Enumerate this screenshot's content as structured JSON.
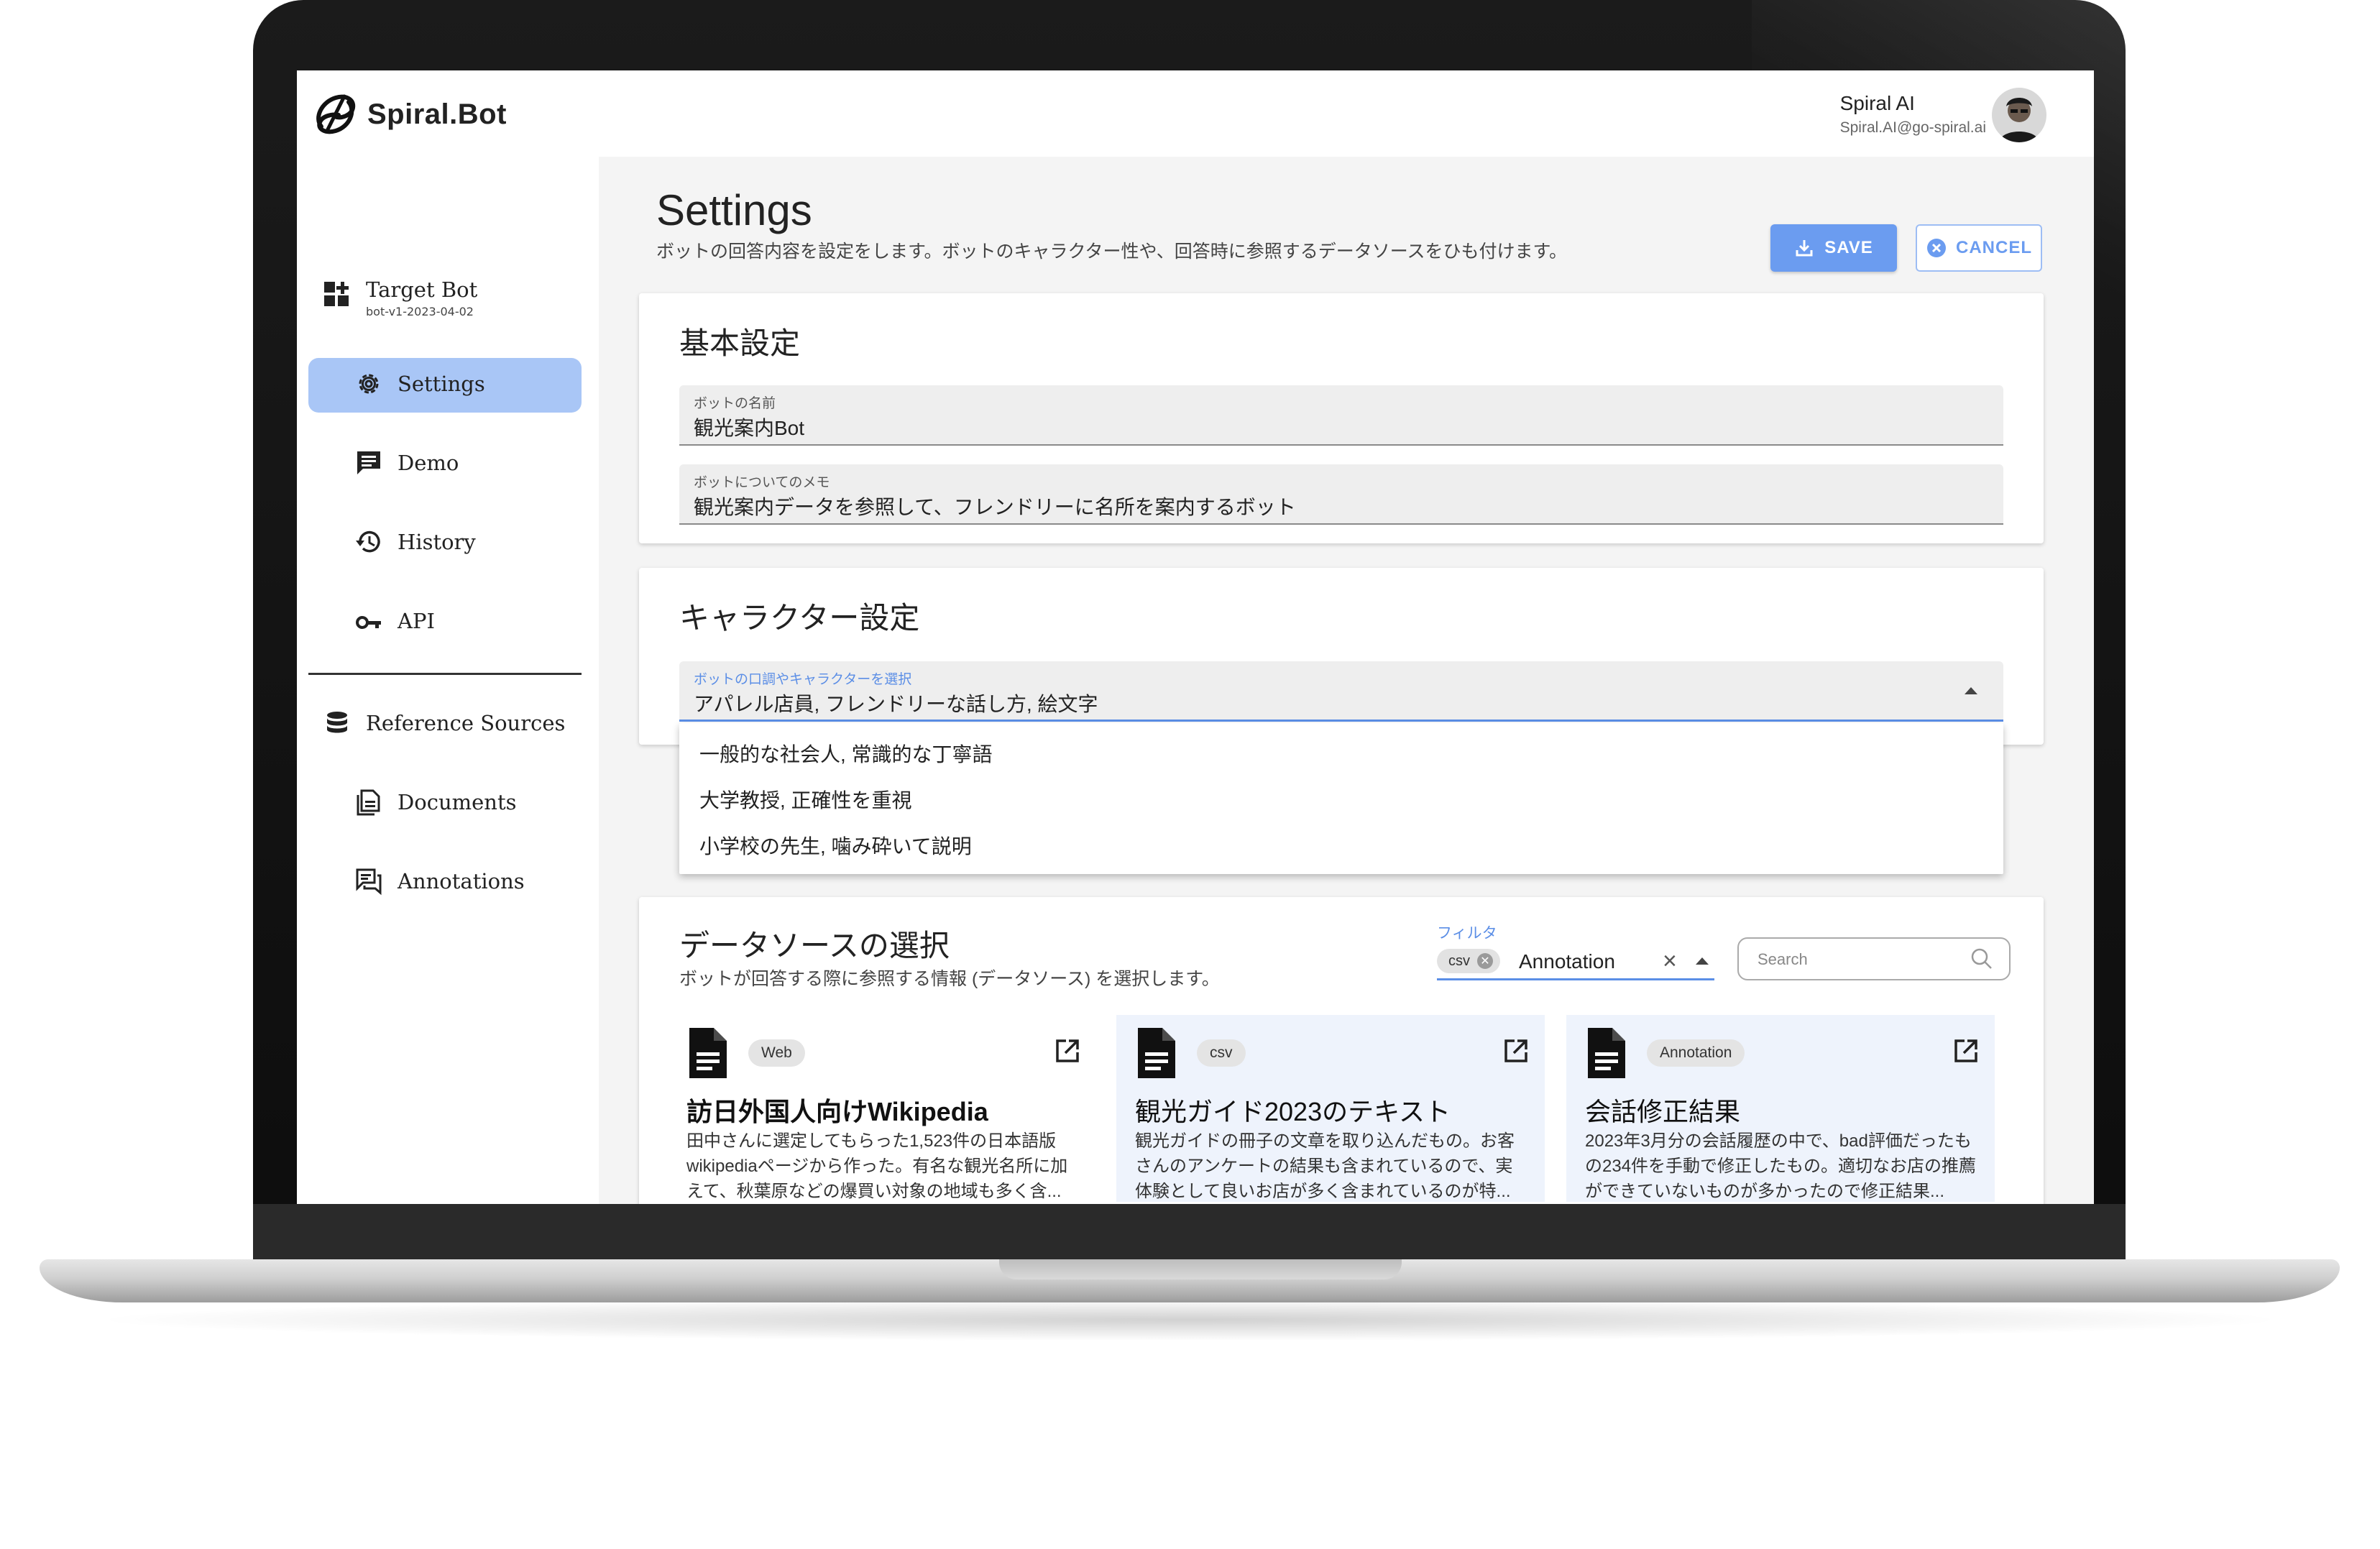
{
  "colors": {
    "accent": "#6b9cf0",
    "active_nav": "#a9c6f6",
    "main_bg": "#f4f4f4",
    "card_tint": "#eef3fc"
  },
  "header": {
    "logo_text": "Spiral.Bot",
    "user_name": "Spiral AI",
    "user_email": "Spiral.AI@go-spiral.ai"
  },
  "sidebar": {
    "target_label": "Target Bot",
    "target_sub": "bot-v1-2023-04-02",
    "items": [
      {
        "label": "Settings",
        "icon": "gear-icon",
        "active": true
      },
      {
        "label": "Demo",
        "icon": "chat-icon",
        "active": false
      },
      {
        "label": "History",
        "icon": "history-icon",
        "active": false
      },
      {
        "label": "API",
        "icon": "key-icon",
        "active": false
      }
    ],
    "reference_label": "Reference Sources",
    "reference_items": [
      {
        "label": "Documents",
        "icon": "documents-icon"
      },
      {
        "label": "Annotations",
        "icon": "annotations-icon"
      }
    ]
  },
  "page": {
    "title": "Settings",
    "subtitle": "ボットの回答内容を設定をします。ボットのキャラクター性や、回答時に参照するデータソースをひも付けます。",
    "save_label": "SAVE",
    "cancel_label": "CANCEL"
  },
  "basic": {
    "title": "基本設定",
    "name_label": "ボットの名前",
    "name_value": "観光案内Bot",
    "memo_label": "ボットについてのメモ",
    "memo_value": "観光案内データを参照して、フレンドリーに名所を案内するボット"
  },
  "character": {
    "title": "キャラクター設定",
    "select_label": "ボットの口調やキャラクターを選択",
    "select_value": "アパレル店員, フレンドリーな話し方, 絵文字",
    "options": [
      "一般的な社会人, 常識的な丁寧語",
      "大学教授, 正確性を重視",
      "小学校の先生, 噛み砕いて説明"
    ]
  },
  "datasource": {
    "title": "データソースの選択",
    "subtitle": "ボットが回答する際に参照する情報 (データソース) を選択します。",
    "filter_label": "フィルタ",
    "filter_chip": "csv",
    "filter_value": "Annotation",
    "search_placeholder": "Search",
    "cards": [
      {
        "badge": "Web",
        "title": "訪日外国人向けWikipedia",
        "desc": "田中さんに選定してもらった1,523件の日本語版wikipediaページから作った。有名な観光名所に加えて、秋葉原などの爆買い対象の地域も多く含..."
      },
      {
        "badge": "csv",
        "title": "観光ガイド2023のテキスト",
        "desc": "観光ガイドの冊子の文章を取り込んだもの。お客さんのアンケートの結果も含まれているので、実体験として良いお店が多く含まれているのが特..."
      },
      {
        "badge": "Annotation",
        "title": "会話修正結果",
        "desc": "2023年3月分の会話履歴の中で、bad評価だったもの234件を手動で修正したもの。適切なお店の推薦ができていないものが多かったので修正結果..."
      }
    ]
  }
}
